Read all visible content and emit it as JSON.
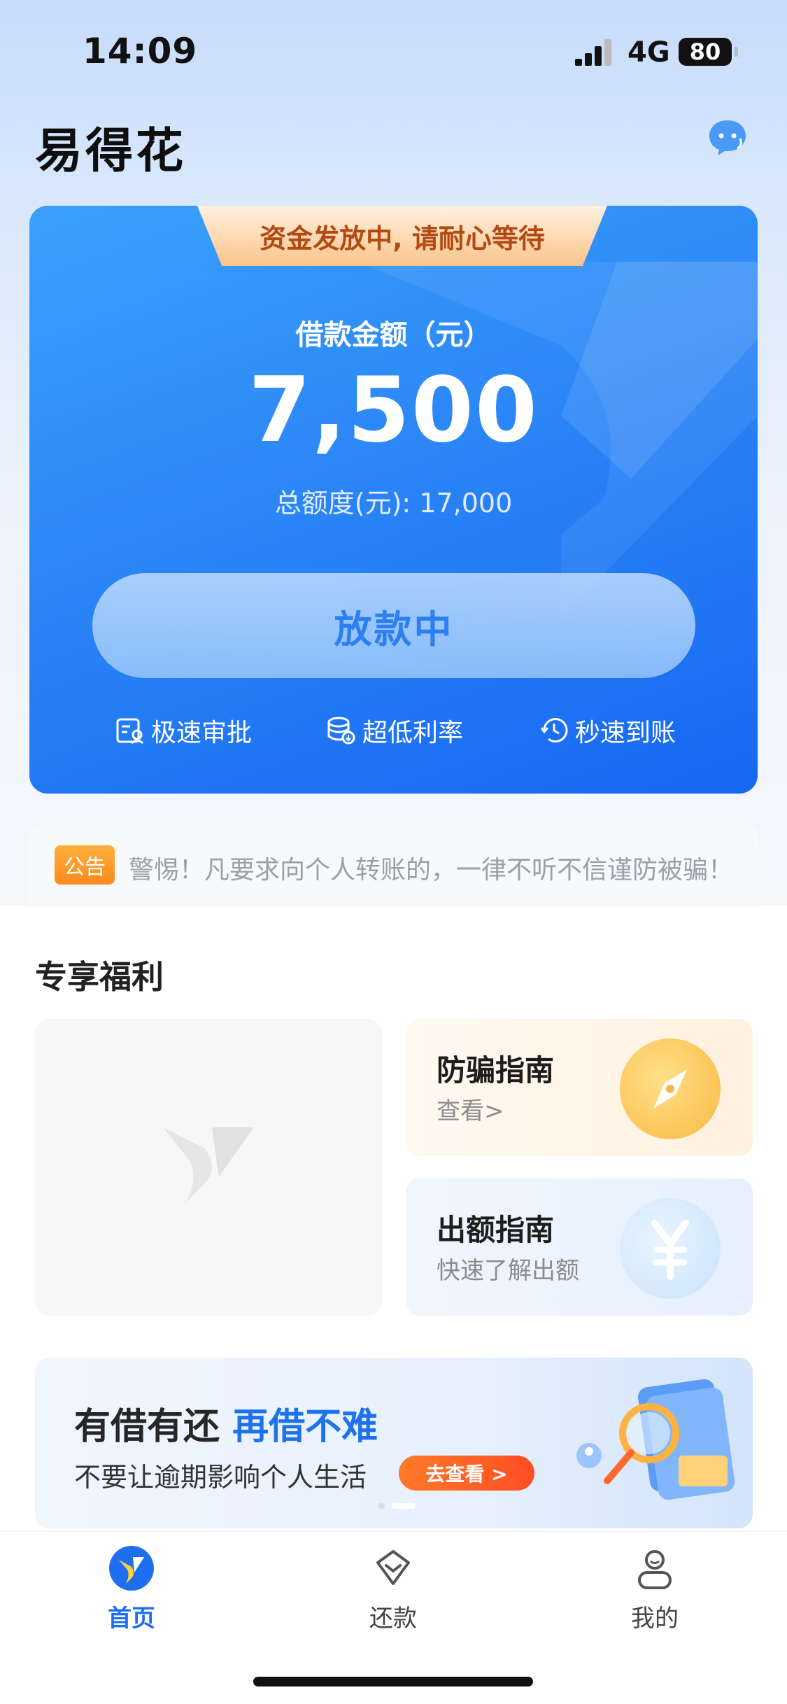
{
  "status_bar": {
    "time": "14:09",
    "network": "4G",
    "battery": "80"
  },
  "header": {
    "app_title": "易得花",
    "service_icon": "customer-service-chat-icon"
  },
  "loan_card": {
    "status_banner": "资金发放中, 请耐心等待",
    "amount_label": "借款金额（元）",
    "amount_value": "7,500",
    "total_limit": "总额度(元): 17,000",
    "action_button": "放款中",
    "features": [
      {
        "icon": "approval-icon",
        "label": "极速审批"
      },
      {
        "icon": "coins-icon",
        "label": "超低利率"
      },
      {
        "icon": "clock-icon",
        "label": "秒速到账"
      }
    ]
  },
  "notice": {
    "tag": "公告",
    "text": "警惕！凡要求向个人转账的，一律不听不信谨防被骗！"
  },
  "benefits": {
    "title": "专享福利",
    "cards": [
      {
        "title": "防骗指南",
        "subtitle": "查看>",
        "icon": "compass-icon"
      },
      {
        "title": "出额指南",
        "subtitle": "快速了解出额",
        "icon": "yuan-icon"
      }
    ]
  },
  "promo": {
    "title_part1": "有借有还",
    "title_highlight": "再借不难",
    "subtitle": "不要让逾期影响个人生活",
    "button": "去查看 >"
  },
  "tab_bar": [
    {
      "label": "首页",
      "icon": "home-logo-icon",
      "active": true
    },
    {
      "label": "还款",
      "icon": "repay-icon",
      "active": false
    },
    {
      "label": "我的",
      "icon": "profile-icon",
      "active": false
    }
  ],
  "colors": {
    "primary": "#1e6ff0",
    "card_start": "#3aa1fb",
    "card_end": "#1668f2",
    "notice_tag": "#ff8a1f",
    "promo_button": "#ff5a24"
  }
}
